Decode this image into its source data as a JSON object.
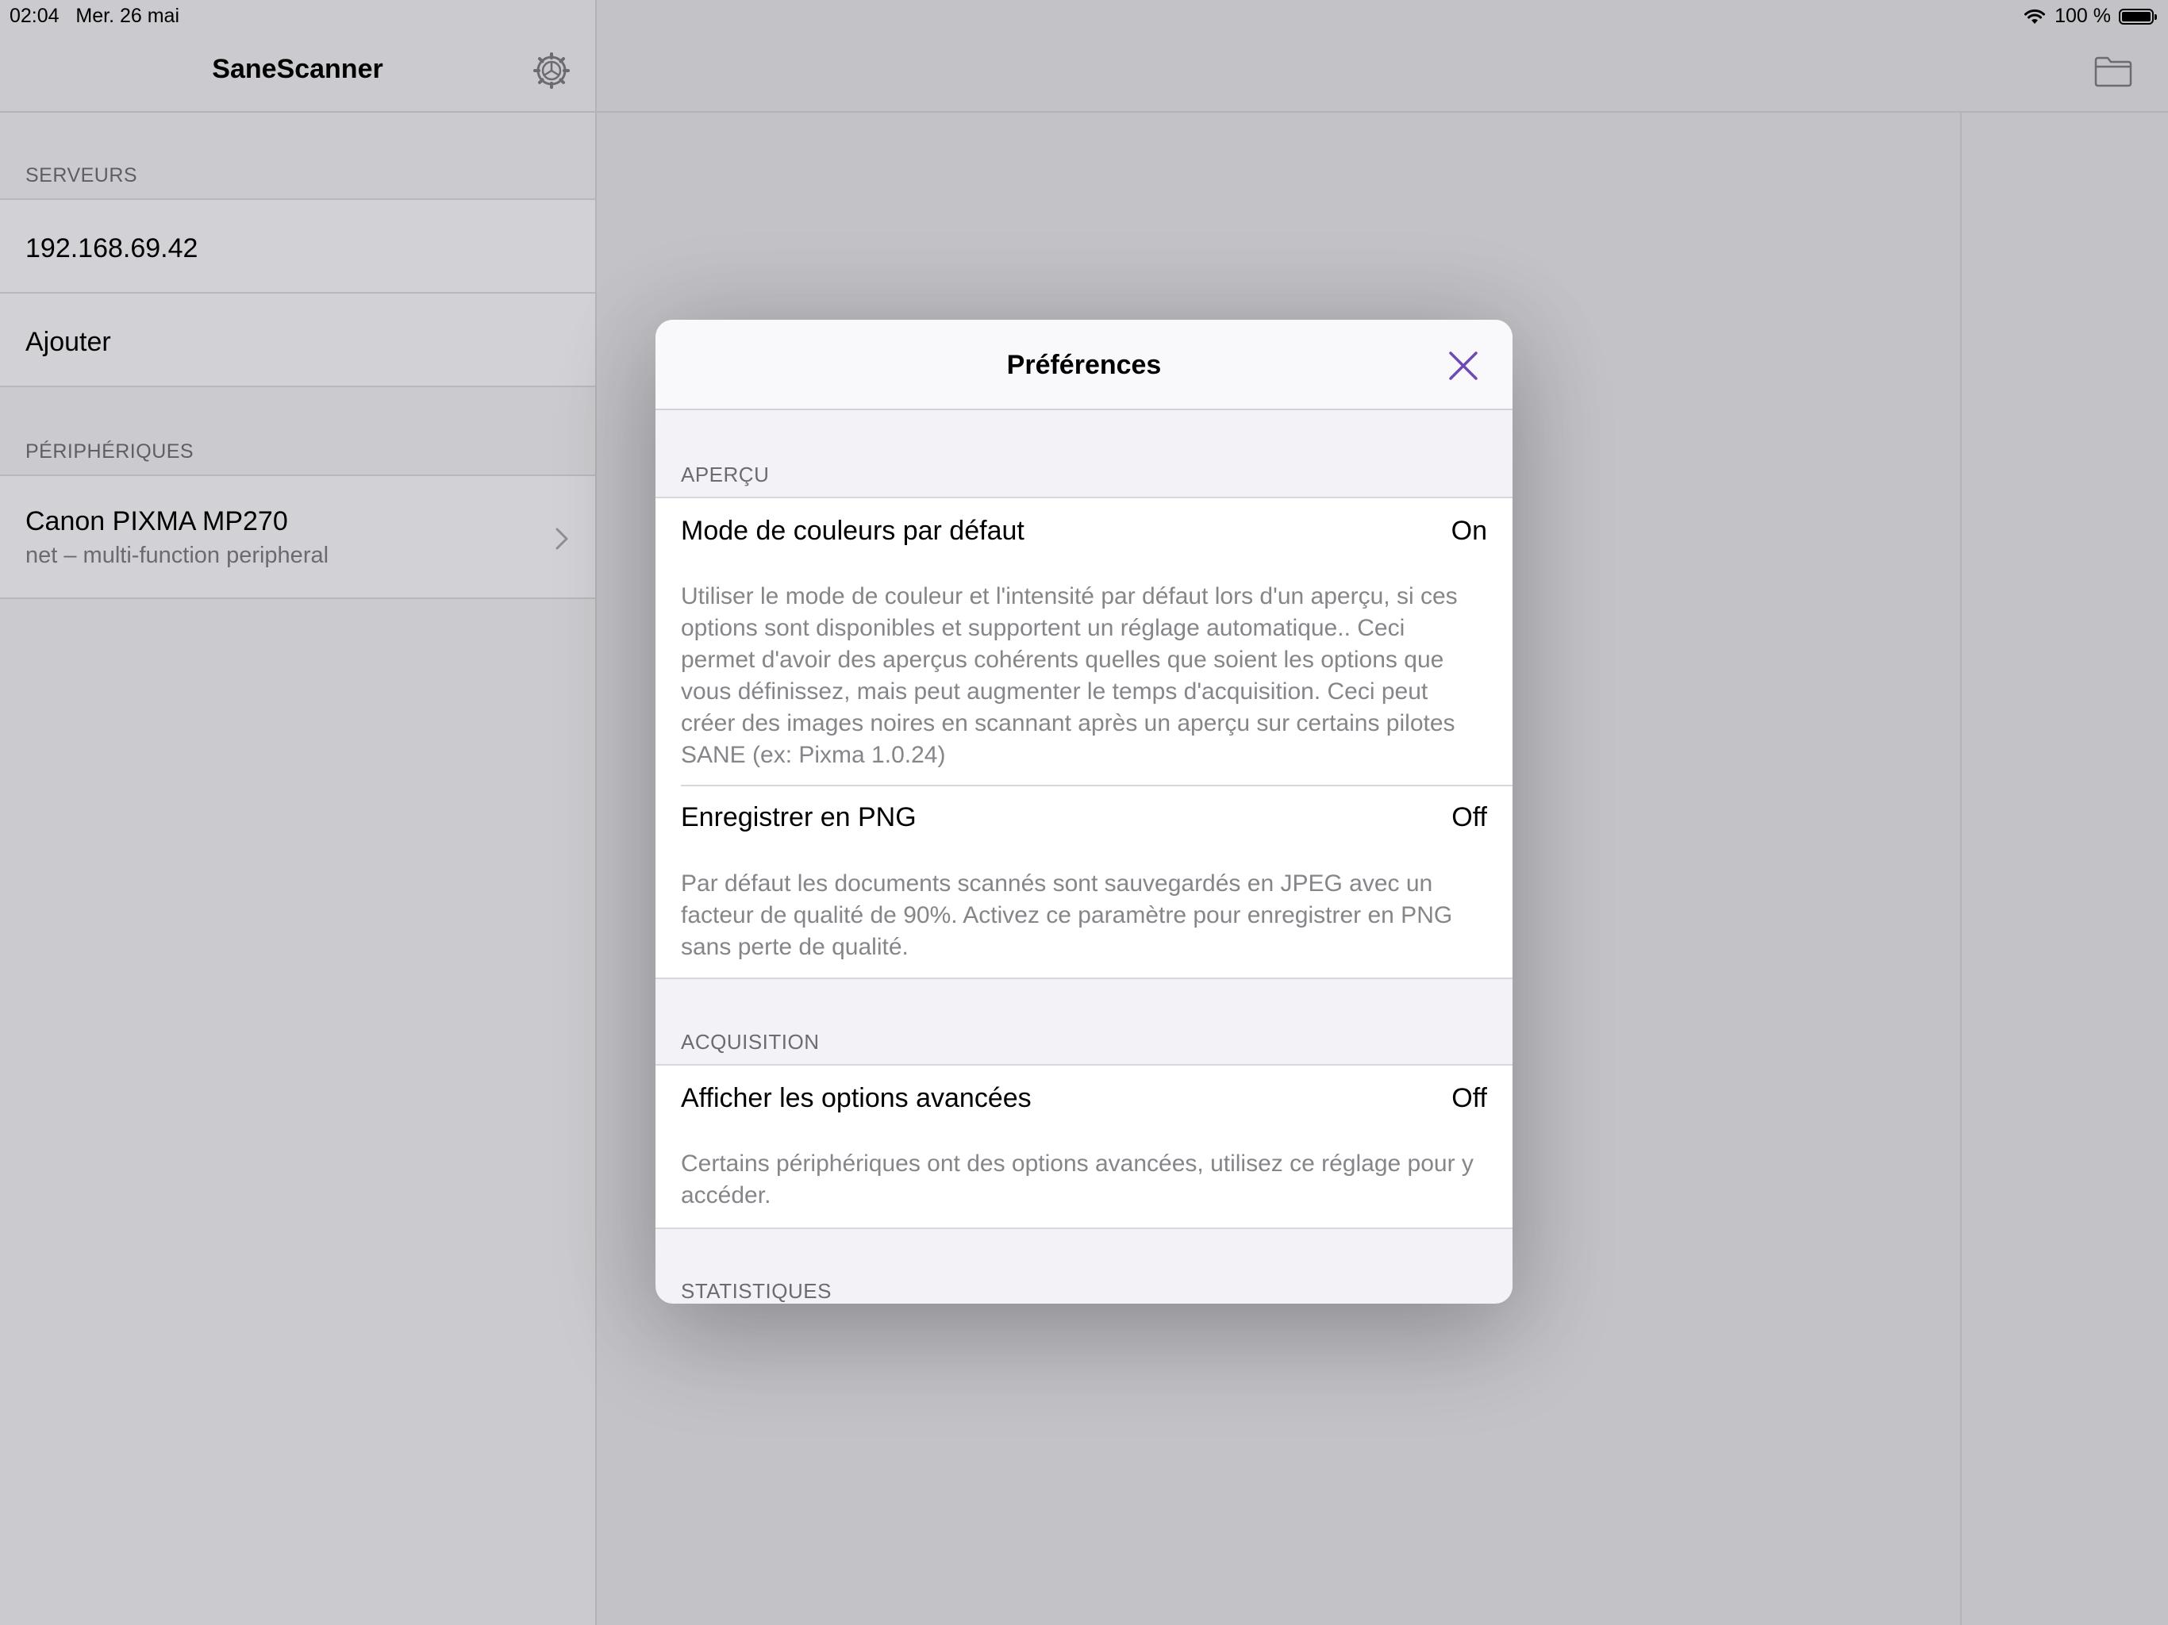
{
  "status_bar": {
    "time": "02:04",
    "date": "Mer. 26 mai",
    "battery": "100 %"
  },
  "sidebar": {
    "title": "SaneScanner",
    "servers_header": "SERVEURS",
    "servers": [
      "192.168.69.42",
      "Ajouter"
    ],
    "devices_header": "PÉRIPHÉRIQUES",
    "device": {
      "name": "Canon PIXMA MP270",
      "subtitle": "net – multi-function peripheral"
    }
  },
  "modal": {
    "title": "Préférences",
    "sections": {
      "preview": {
        "header": "APERÇU",
        "rows": [
          {
            "label": "Mode de couleurs par défaut",
            "value": "On",
            "description": "Utiliser le mode de couleur et l'intensité par défaut lors d'un aperçu, si ces options sont disponibles et supportent un réglage automatique.. Ceci permet d'avoir des aperçus cohérents quelles que soient les options que vous définissez, mais peut augmenter le temps d'acquisition. Ceci peut créer des images noires en scannant après un aperçu sur certains pilotes SANE (ex: Pixma 1.0.24)"
          },
          {
            "label": "Enregistrer en PNG",
            "value": "Off",
            "description": "Par défaut les documents scannés sont sauvegardés en JPEG avec un facteur de qualité de 90%. Activez ce paramètre pour enregistrer en PNG sans perte de qualité."
          }
        ]
      },
      "acquisition": {
        "header": "ACQUISITION",
        "rows": [
          {
            "label": "Afficher les options avancées",
            "value": "Off",
            "description": "Certains périphériques ont des options avancées, utilisez ce réglage pour y accéder."
          }
        ]
      },
      "stats": {
        "header": "STATISTIQUES"
      }
    }
  },
  "colors": {
    "accent": "#6e4bb4",
    "dim_background": "#c3c3c8",
    "modal_background": "#f2f2f7"
  },
  "icons": {
    "settings": "gear-icon",
    "documents": "folder-icon",
    "close": "close-icon",
    "disclosure": "chevron-right-icon",
    "wifi": "wifi-icon",
    "battery": "battery-icon"
  }
}
